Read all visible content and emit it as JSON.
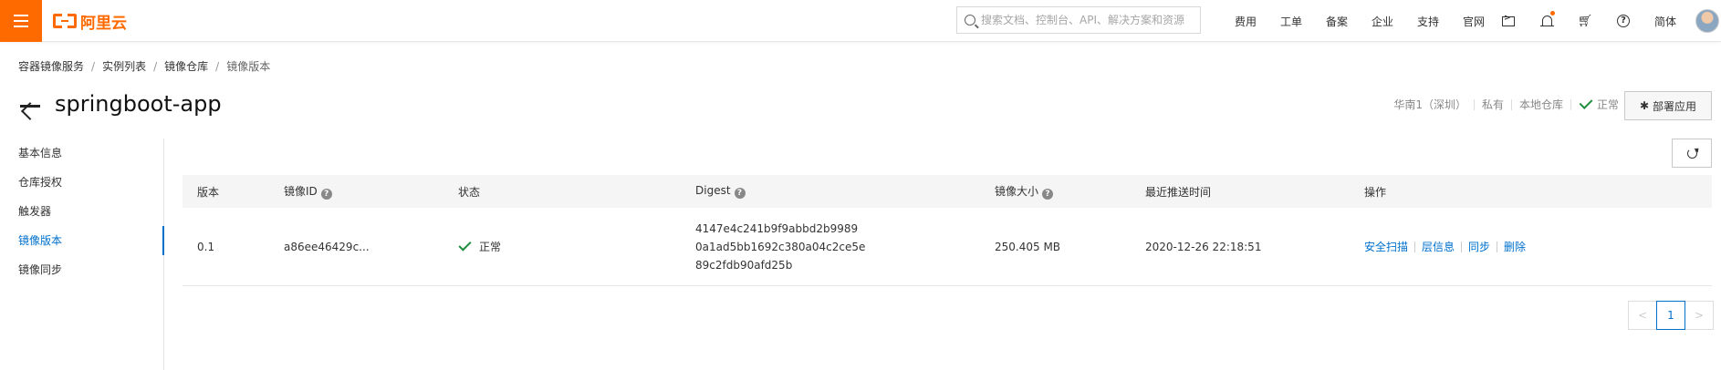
{
  "header": {
    "logo_text": "阿里云",
    "search_placeholder": "搜索文档、控制台、API、解决方案和资源",
    "links": [
      "费用",
      "工单",
      "备案",
      "企业",
      "支持",
      "官网"
    ],
    "lang": "简体",
    "accent_color": "#ff6a00"
  },
  "breadcrumb": [
    "容器镜像服务",
    "实例列表",
    "镜像仓库",
    "镜像版本"
  ],
  "page": {
    "title": "springboot-app",
    "meta": {
      "region": "华南1（深圳）",
      "visibility": "私有",
      "source": "本地仓库",
      "status": "正常"
    },
    "deploy_label": "部署应用"
  },
  "sidebar": {
    "items": [
      {
        "label": "基本信息"
      },
      {
        "label": "仓库授权"
      },
      {
        "label": "触发器"
      },
      {
        "label": "镜像版本"
      },
      {
        "label": "镜像同步"
      }
    ],
    "active_index": 3
  },
  "table": {
    "headers": {
      "version": "版本",
      "image_id": "镜像ID",
      "status": "状态",
      "digest": "Digest",
      "size": "镜像大小",
      "pushed": "最近推送时间",
      "ops": "操作"
    },
    "rows": [
      {
        "version": "0.1",
        "image_id": "a86ee46429c...",
        "status": "正常",
        "digest": [
          "4147e4c241b9f9abbd2b9989",
          "0a1ad5bb1692c380a04c2ce5e",
          "89c2fdb90afd25b"
        ],
        "size": "250.405 MB",
        "pushed": "2020-12-26 22:18:51",
        "actions": [
          "安全扫描",
          "层信息",
          "同步",
          "删除"
        ]
      }
    ]
  },
  "pagination": {
    "current": "1",
    "prev": "<",
    "next": ">"
  }
}
